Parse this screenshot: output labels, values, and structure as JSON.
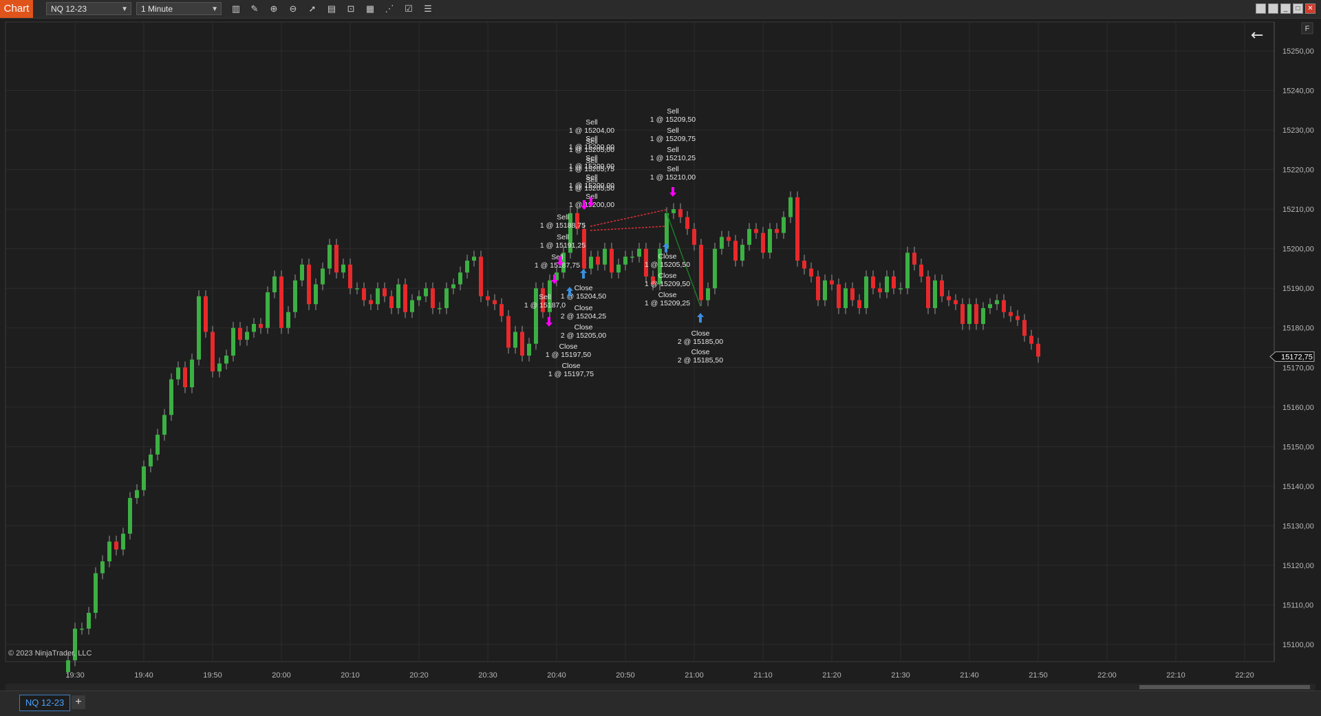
{
  "window": {
    "tag": "Chart",
    "instrument": "NQ 12-23",
    "interval": "1 Minute",
    "tab": "NQ 12-23",
    "copyright": "© 2023 NinjaTrader, LLC",
    "flat_label": "F",
    "toolbar_icons": [
      "bar-type-icon",
      "draw-pencil-icon",
      "zoom-in-icon",
      "zoom-out-icon",
      "pointer-icon",
      "data-box-icon",
      "strategies-icon",
      "indicators-icon",
      "chart-trader-icon",
      "properties-icon",
      "list-icon"
    ]
  },
  "chart_data": {
    "type": "candlestick",
    "background": "#1e1e1e",
    "up_color": "#3cb043",
    "down_color": "#e8292b",
    "grid": true,
    "last_price_label": "15172,75",
    "y_ticks": [
      "15250,00",
      "15240,00",
      "15230,00",
      "15220,00",
      "15210,00",
      "15200,00",
      "15190,00",
      "15180,00",
      "15170,00",
      "15160,00",
      "15150,00",
      "15140,00",
      "15130,00",
      "15120,00",
      "15110,00",
      "15100,00"
    ],
    "x_ticks": [
      "19:30",
      "19:40",
      "19:50",
      "20:00",
      "20:10",
      "20:20",
      "20:30",
      "20:40",
      "20:50",
      "21:00",
      "21:10",
      "21:20",
      "21:30",
      "21:40",
      "21:50",
      "22:00",
      "22:10",
      "22:20"
    ],
    "closes": [
      15096,
      15104,
      15104,
      15108,
      15118,
      15121,
      15126,
      15124,
      15128,
      15137,
      15139,
      15145,
      15148,
      15153,
      15158,
      15167,
      15170,
      15165,
      15172,
      15188,
      15179,
      15169,
      15171,
      15173,
      15180,
      15177,
      15179,
      15181,
      15180,
      15189,
      15193,
      15180,
      15184,
      15192,
      15196,
      15186,
      15191,
      15195,
      15201,
      15194,
      15196,
      15190,
      15190,
      15187,
      15186,
      15190,
      15188,
      15185,
      15191,
      15184,
      15187,
      15188,
      15190,
      15185,
      15185,
      15190,
      15191,
      15194,
      15197,
      15198,
      15188,
      15187,
      15186,
      15183,
      15175,
      15179,
      15173,
      15176,
      15190,
      15184,
      15192,
      15194,
      15199,
      15209,
      15205,
      15195,
      15198,
      15196,
      15200,
      15194,
      15196,
      15198,
      15198,
      15200,
      15193,
      15191,
      15200,
      15209,
      15210,
      15208,
      15205,
      15201,
      15187,
      15190,
      15200,
      15203,
      15202,
      15197,
      15201,
      15205,
      15204,
      15199,
      15205,
      15204,
      15208,
      15213,
      15197,
      15195,
      15193,
      15187,
      15192,
      15191,
      15185,
      15190,
      15187,
      15185,
      15193,
      15190,
      15189,
      15193,
      15190,
      15190,
      15199,
      15196,
      15193,
      15185,
      15192,
      15188,
      15187,
      15186,
      15181,
      15186,
      15181,
      15185,
      15186,
      15187,
      15184,
      15183,
      15182,
      15178,
      15176,
      15172.75
    ]
  },
  "orders": [
    {
      "lines": [
        "Sell",
        "1 @ 15204,00",
        "Sell",
        "1 @ 15200,00"
      ],
      "arrow": "down"
    },
    {
      "lines": [
        "Sell",
        "1 @ 15205,00",
        "Sell",
        "1 @ 15200,00"
      ]
    },
    {
      "lines": [
        "Sell",
        "1 @ 15205,75",
        "Sell",
        "1 @ 15200,00"
      ]
    },
    {
      "lines": [
        "Sell",
        "1 @ 15205,50",
        "Sell",
        "1 @ 15200,00"
      ]
    },
    {
      "lines": [
        "Sell",
        "1 @ 15188,75"
      ]
    },
    {
      "lines": [
        "Sell",
        "1 @ 15191,25"
      ]
    },
    {
      "lines": [
        "Sell",
        "1 @ 15187,75"
      ]
    },
    {
      "lines": [
        "Sell",
        "1 @ 15187,0"
      ]
    },
    {
      "lines": [
        "Close",
        "1 @ 15204,50"
      ]
    },
    {
      "lines": [
        "Close",
        "2 @ 15204,25"
      ]
    },
    {
      "lines": [
        "Close",
        "2 @ 15205,00"
      ]
    },
    {
      "lines": [
        "Close",
        "1 @ 15197,50"
      ]
    },
    {
      "lines": [
        "Close",
        "1 @ 15197,75"
      ]
    },
    {
      "lines": [
        "Sell",
        "1 @ 15209,50"
      ]
    },
    {
      "lines": [
        "Sell",
        "1 @ 15209,75"
      ]
    },
    {
      "lines": [
        "Sell",
        "1 @ 15210,25"
      ]
    },
    {
      "lines": [
        "Sell",
        "1 @ 15210,00"
      ]
    },
    {
      "lines": [
        "Close",
        "1 @ 15205,50"
      ]
    },
    {
      "lines": [
        "Close",
        "1 @ 15209,50"
      ]
    },
    {
      "lines": [
        "Close",
        "1 @ 15209,25"
      ]
    },
    {
      "lines": [
        "Close",
        "2 @ 15185,00"
      ]
    },
    {
      "lines": [
        "Close",
        "2 @ 15185,50"
      ]
    }
  ]
}
